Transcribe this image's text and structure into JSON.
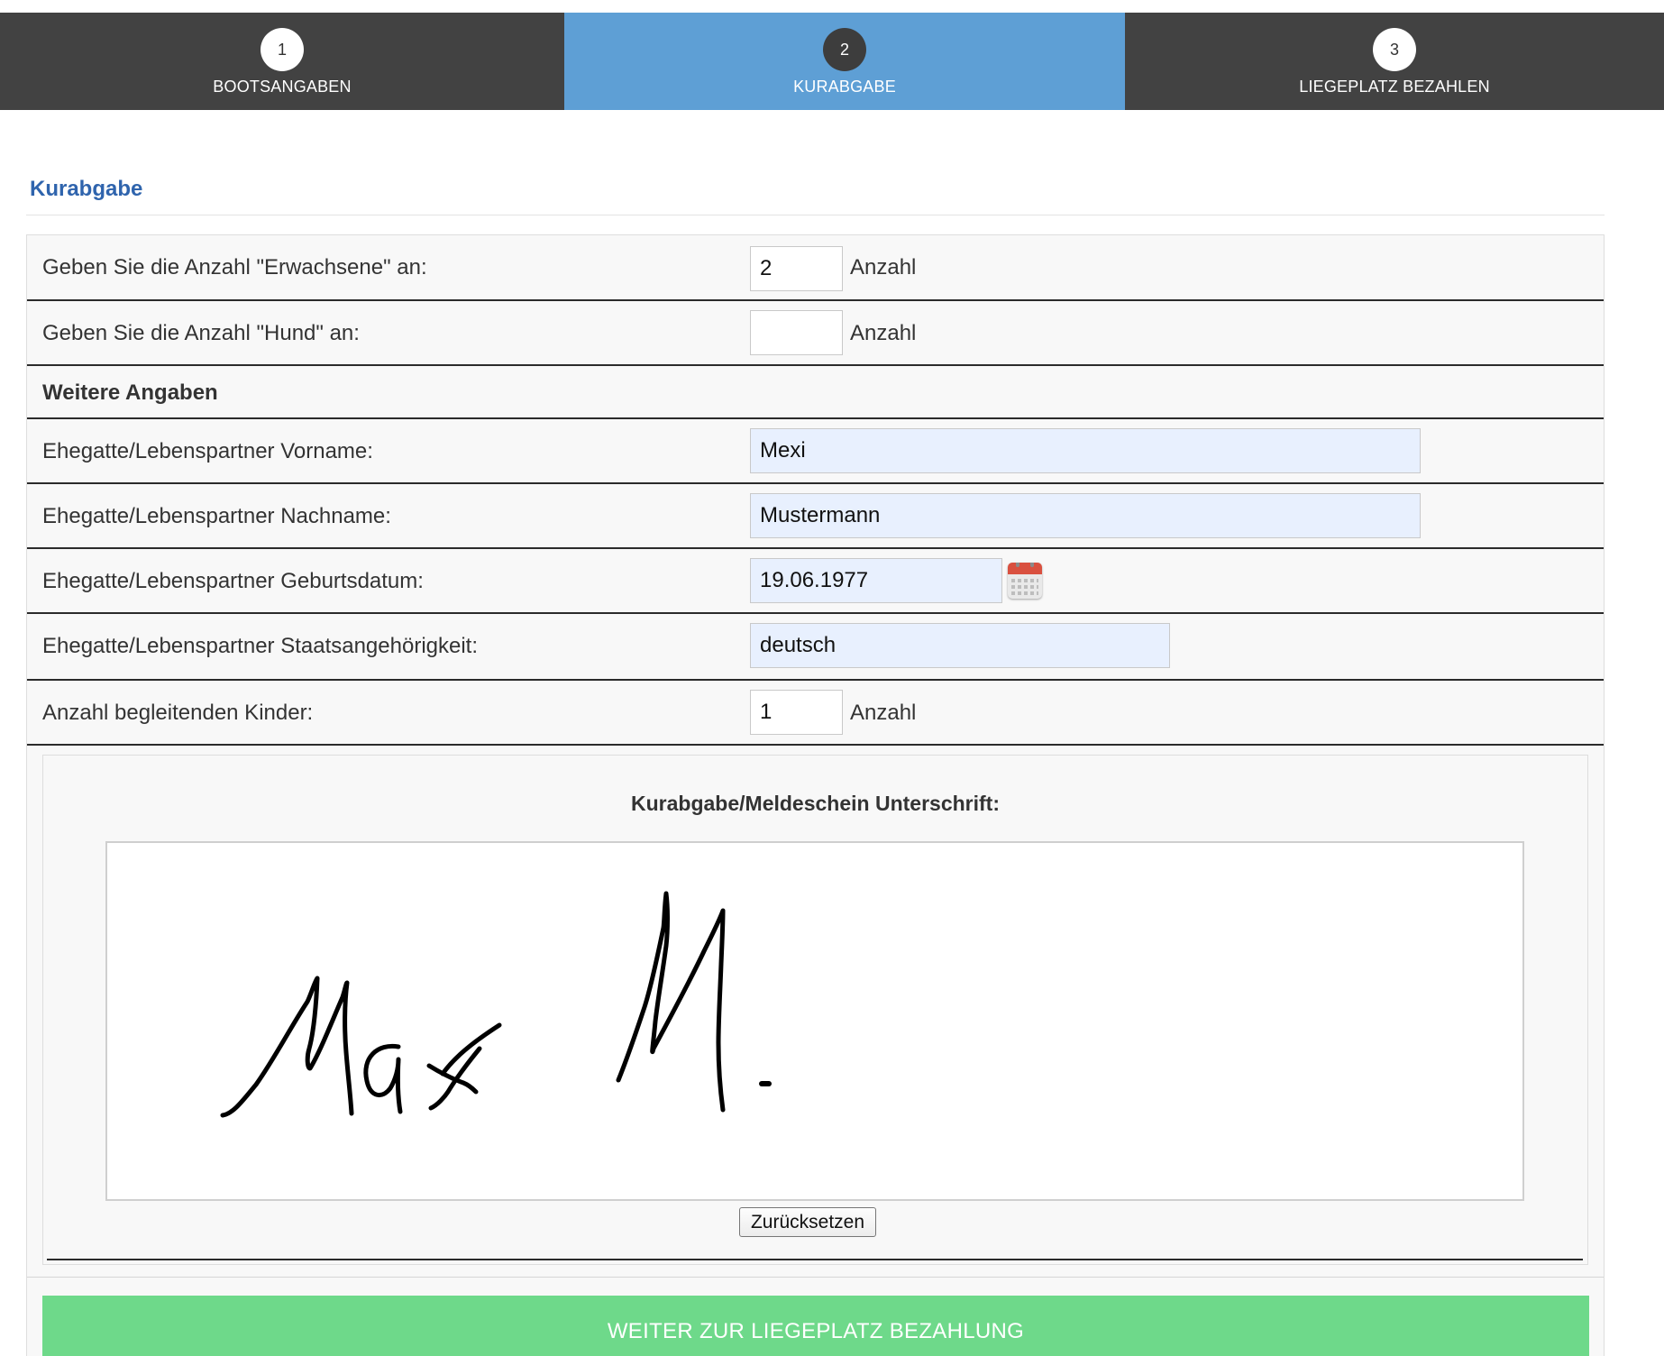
{
  "steps": [
    {
      "number": "1",
      "label": "BOOTSANGABEN",
      "state": "done"
    },
    {
      "number": "2",
      "label": "KURABGABE",
      "state": "active"
    },
    {
      "number": "3",
      "label": "LIEGEPLATZ BEZAHLEN",
      "state": "upcoming"
    }
  ],
  "section": {
    "title": "Kurabgabe"
  },
  "form": {
    "adults": {
      "label": "Geben Sie die Anzahl \"Erwachsene\" an:",
      "value": "2",
      "unit": "Anzahl"
    },
    "dogs": {
      "label": "Geben Sie die Anzahl \"Hund\" an:",
      "value": "",
      "unit": "Anzahl"
    },
    "more_heading": "Weitere Angaben",
    "partner_firstname": {
      "label": "Ehegatte/Lebenspartner Vorname:",
      "value": "Mexi"
    },
    "partner_lastname": {
      "label": "Ehegatte/Lebenspartner Nachname:",
      "value": "Mustermann"
    },
    "partner_birthdate": {
      "label": "Ehegatte/Lebenspartner Geburtsdatum:",
      "value": "19.06.1977",
      "icon": "calendar-icon"
    },
    "partner_nationality": {
      "label": "Ehegatte/Lebenspartner Staatsangehörigkeit:",
      "value": "deutsch"
    },
    "children": {
      "label": "Anzahl begleitenden Kinder:",
      "value": "1",
      "unit": "Anzahl"
    }
  },
  "signature": {
    "title": "Kurabgabe/Meldeschein Unterschrift:",
    "signed_text": "Max M.",
    "reset_label": "Zurücksetzen"
  },
  "submit": {
    "label": "WEITER ZUR LIEGEPLATZ BEZAHLUNG"
  },
  "colors": {
    "step_bg": "#424242",
    "step_active_bg": "#5e9fd5",
    "title_blue": "#2f64ad",
    "autofill_bg": "#e8f0fe",
    "submit_green": "#6ed98a",
    "calendar_red": "#d9503f"
  }
}
